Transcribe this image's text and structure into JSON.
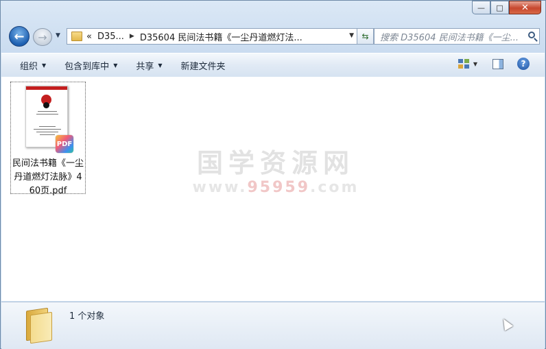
{
  "window": {
    "controls": {
      "minimize": "—",
      "maximize": "□",
      "close": "✕"
    }
  },
  "nav": {
    "back_glyph": "←",
    "forward_glyph": "→",
    "address": {
      "overflow": "«",
      "segments": [
        "D35...",
        "D35604 民间法书籍《一尘丹道燃灯法..."
      ]
    },
    "search_placeholder": "搜索 D35604 民间法书籍《一尘..."
  },
  "toolbar": {
    "organize": "组织",
    "include_in_library": "包含到库中",
    "share": "共享",
    "new_folder": "新建文件夹",
    "help": "?"
  },
  "files": [
    {
      "name": "民间法书籍《一尘丹道燃灯法脉》460页.pdf",
      "badge": "PDF",
      "icon": "pdf-file-icon"
    }
  ],
  "watermark": {
    "line1": "国学资源网",
    "line2_prefix": "www.",
    "line2_red": "95959",
    "line2_suffix": ".com"
  },
  "status": {
    "count_text": "1 个对象"
  },
  "colors": {
    "accent": "#1d5fb0",
    "close": "#c7472e",
    "watermark_red": "#f1c7c7"
  }
}
